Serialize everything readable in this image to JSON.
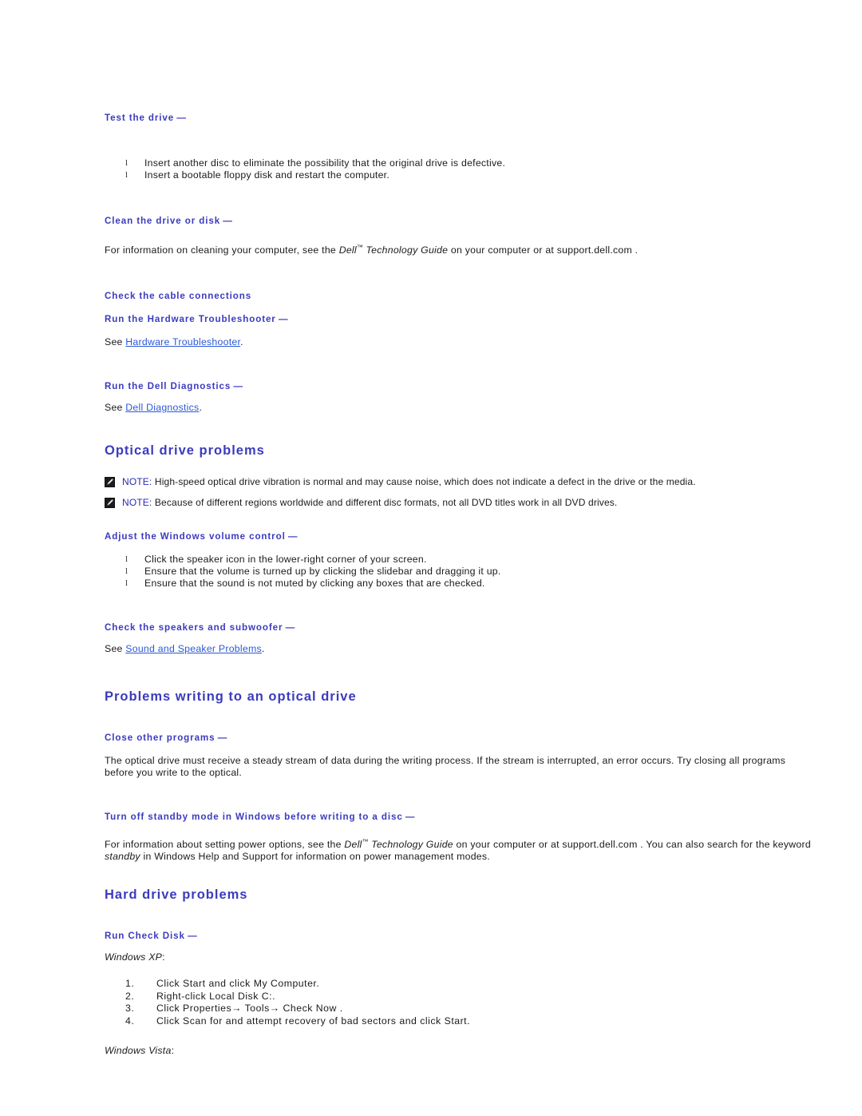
{
  "document": {
    "sections": [
      {
        "id": "test-the-drive",
        "subhead": "Test the drive",
        "dash": " —",
        "bullets": [
          "Insert another disc to eliminate the possibility that the original drive is defective.",
          "Insert a bootable floppy disk and restart the computer."
        ]
      },
      {
        "id": "clean-the-drive-or-disk",
        "subhead": "Clean the drive or disk",
        "dash": " —",
        "paragraph_pre": "For information on cleaning your computer, see the ",
        "paragraph_italic": "Dell",
        "paragraph_tm": "™",
        "paragraph_italic2": " Technology Guide",
        "paragraph_post": " on your computer or at support.dell.com ."
      },
      {
        "id": "check-the-cable-connections",
        "subhead": "Check the cable connections",
        "dash": ""
      },
      {
        "id": "run-the-hardware-troubleshooter",
        "subhead": "Run the Hardware Troubleshooter",
        "dash": " —",
        "see_prefix": "See ",
        "link_text": "Hardware Troubleshooter",
        "see_suffix": "."
      },
      {
        "id": "run-the-dell-diagnostics",
        "subhead": "Run the Dell Diagnostics",
        "dash": " —",
        "see_prefix": "See ",
        "link_text": "Dell Diagnostics",
        "see_suffix": "."
      }
    ],
    "optical_drive_problems": {
      "heading": "Optical drive problems",
      "notes": [
        {
          "label": "NOTE:",
          "text": " High-speed optical drive vibration is normal and may cause noise, which does not indicate a defect in the drive or the media.",
          "icon": "note-pencil-icon"
        },
        {
          "label": "NOTE:",
          "text": " Because of different regions worldwide and different disc formats, not all DVD titles work in all DVD drives.",
          "icon": "note-pencil-icon"
        }
      ],
      "volume_control": {
        "subhead": "Adjust the Windows volume control",
        "dash": " —",
        "bullets": [
          "Click the speaker icon in the lower-right corner of your screen.",
          "Ensure that the volume is turned up by clicking the slidebar and dragging it up.",
          "Ensure that the sound is not muted by clicking any boxes that are checked."
        ]
      },
      "speakers": {
        "subhead": "Check the speakers and subwoofer",
        "dash": " —",
        "see_prefix": "See ",
        "link_text": "Sound and Speaker Problems",
        "see_suffix": "."
      }
    },
    "problems_writing": {
      "heading": "Problems writing to an optical drive",
      "close_other_programs": {
        "subhead": "Close other programs",
        "dash": " —",
        "paragraph": "The optical drive must receive a steady stream of data during the writing process. If the stream is interrupted, an error occurs. Try closing all programs before you write to the optical."
      },
      "standby": {
        "subhead": "Turn off standby mode in Windows before writing to a disc",
        "dash": " —",
        "paragraph_pre": "For information about setting power options, see the ",
        "paragraph_italic": "Dell",
        "paragraph_tm": "™",
        "paragraph_italic2": " Technology Guide",
        "paragraph_mid": " on your computer or at support.dell.com . You can also search for the keyword ",
        "paragraph_italic3": "standby",
        "paragraph_post": " in Windows Help and Support for information on power management modes."
      }
    },
    "hard_drive_problems": {
      "heading": "Hard drive problems",
      "run_check_disk": {
        "subhead": "Run Check Disk",
        "dash": " —",
        "os_xp_label": "Windows XP",
        "os_xp_punct": ":",
        "steps": [
          "Click Start and click My Computer.",
          "Right-click Local Disk C:.",
          "Click Properties→ Tools→ Check Now .",
          "Click Scan for and attempt recovery of bad sectors and click Start."
        ],
        "os_vista_label": "Windows Vista",
        "os_vista_punct": ":"
      }
    }
  },
  "colors": {
    "heading_blue": "#3b3bbf",
    "link_blue": "#2b59d6",
    "note_blue": "#2a2ab5",
    "body_black": "#1a1a1a"
  }
}
